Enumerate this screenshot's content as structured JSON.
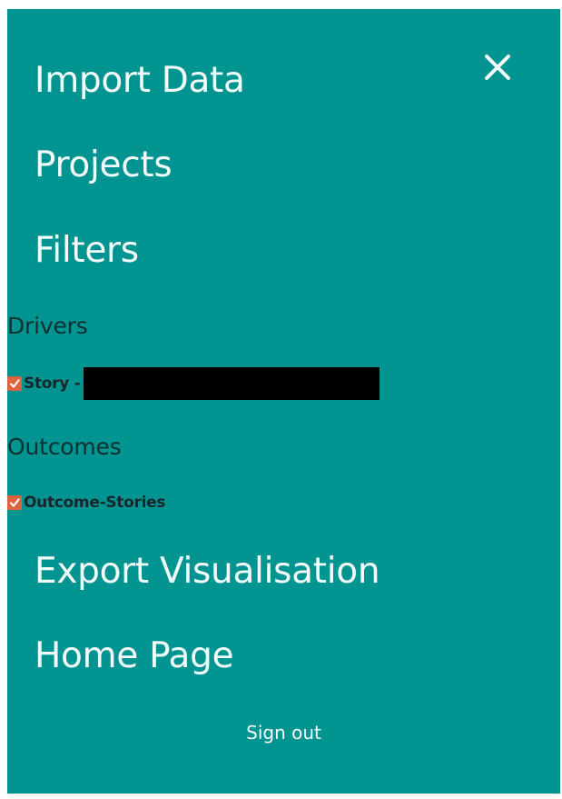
{
  "menu": {
    "close_icon": "close-icon",
    "items": [
      {
        "label": "Import Data"
      },
      {
        "label": "Projects"
      },
      {
        "label": "Filters"
      }
    ],
    "filters": {
      "drivers": {
        "heading": "Drivers",
        "options": [
          {
            "label": "Story -",
            "checked": true,
            "redacted_suffix": true
          }
        ]
      },
      "outcomes": {
        "heading": "Outcomes",
        "options": [
          {
            "label": "Outcome-Stories",
            "checked": true
          }
        ]
      }
    },
    "bottom_items": [
      {
        "label": "Export Visualisation"
      },
      {
        "label": "Home Page"
      }
    ],
    "sign_out_label": "Sign out"
  },
  "colors": {
    "panel_background": "#029491",
    "menu_text": "#f4fbfb",
    "section_text": "#0f2f31",
    "checkbox": "#e0633f"
  }
}
